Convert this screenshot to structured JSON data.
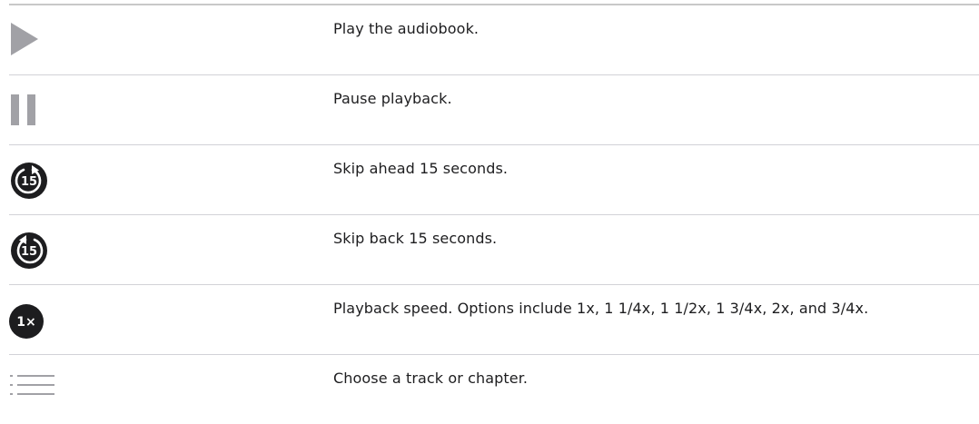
{
  "rows": [
    {
      "icon": "play-icon",
      "description": "Play the audiobook."
    },
    {
      "icon": "pause-icon",
      "description": "Pause playback."
    },
    {
      "icon": "skip-forward-15-icon",
      "icon_label": "15",
      "description": "Skip ahead 15 seconds."
    },
    {
      "icon": "skip-back-15-icon",
      "icon_label": "15",
      "description": "Skip back 15 seconds."
    },
    {
      "icon": "playback-speed-icon",
      "icon_label": "1×",
      "description": "Playback speed. Options include 1x, 1 1/4x, 1 1/2x, 1 3/4x, 2x, and 3/4x."
    },
    {
      "icon": "list-icon",
      "description": "Choose a track or chapter."
    }
  ],
  "colors": {
    "icon_gray": "#a1a1a6",
    "icon_dark": "#1d1d1f",
    "divider": "#d2d2d7",
    "text": "#1d1d1f"
  }
}
